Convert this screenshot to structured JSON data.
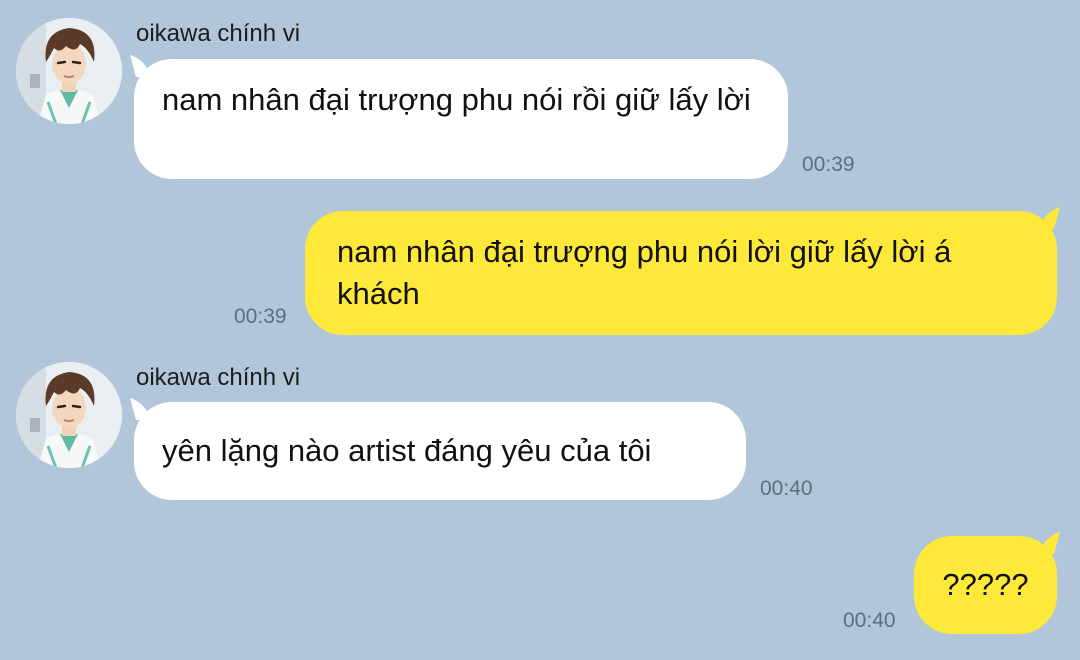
{
  "chat": {
    "messages": [
      {
        "direction": "incoming",
        "sender": "oikawa chính vi",
        "text": "nam nhân đại trượng phu nói rồi giữ lấy lời",
        "time": "00:39"
      },
      {
        "direction": "outgoing",
        "text": "nam nhân đại trượng phu nói lời giữ lấy lời á khách",
        "time": "00:39"
      },
      {
        "direction": "incoming",
        "sender": "oikawa chính vi",
        "text": "yên lặng nào artist đáng yêu của tôi",
        "time": "00:40"
      },
      {
        "direction": "outgoing",
        "text": "?????",
        "time": "00:40"
      }
    ]
  },
  "colors": {
    "background": "#b1c6da",
    "incoming_bubble": "#ffffff",
    "outgoing_bubble": "#fee93a",
    "timestamp": "#5f6e7c"
  },
  "icons": {
    "avatar": "avatar-icon"
  }
}
